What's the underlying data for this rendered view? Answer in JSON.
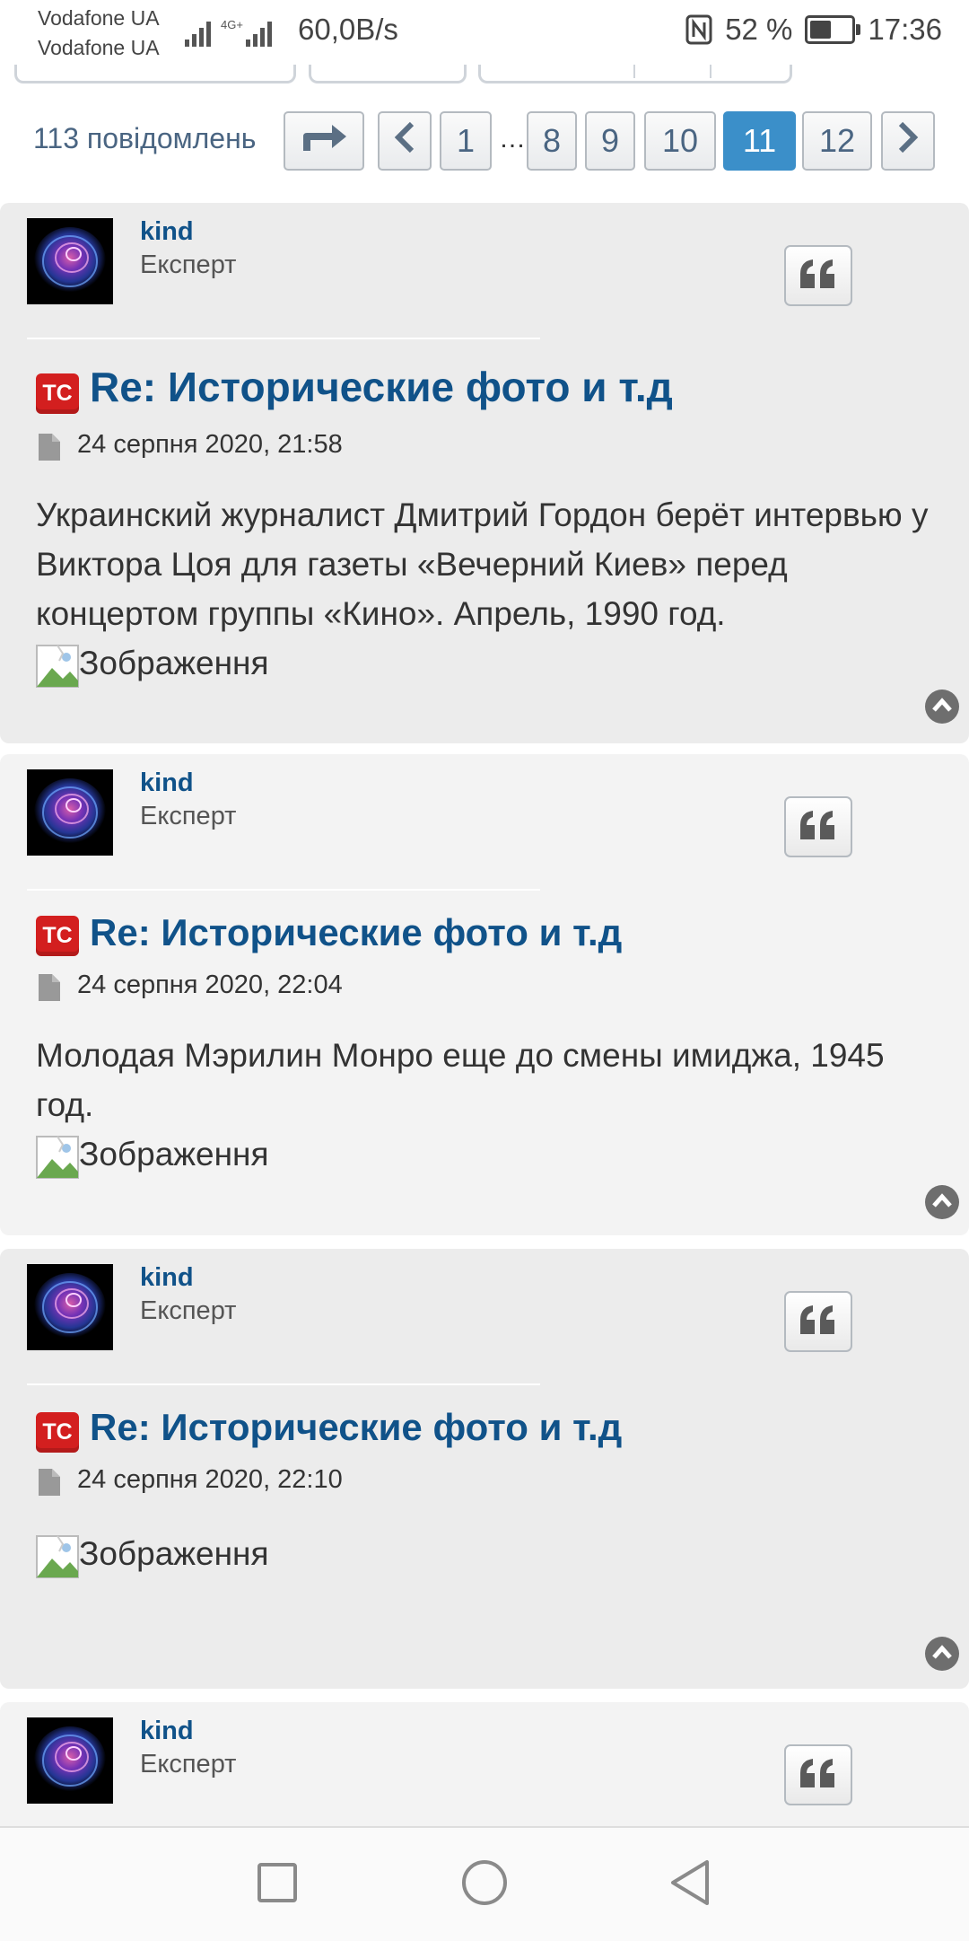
{
  "status_bar": {
    "carrier_1": "Vodafone UA",
    "carrier_2": "Vodafone UA",
    "network": "4G+",
    "speed": "60,0B/s",
    "nfc_icon": "nfc-icon",
    "battery": "52 %",
    "battery_level": 0.52,
    "time": "17:36"
  },
  "pagination": {
    "count_label": "113 повідомлень",
    "jump_icon": "jump-to-page-icon",
    "prev_icon": "chevron-left-icon",
    "pages": [
      "1",
      "…",
      "8",
      "9",
      "10",
      "11",
      "12"
    ],
    "current": "11",
    "next_icon": "chevron-right-icon"
  },
  "posts": [
    {
      "author": "kind",
      "rank": "Експерт",
      "badge": "ТС",
      "title": "Re: Исторические фото и т.д",
      "date": "24 серпня 2020, 21:58",
      "text": "Украинский журналист Дмитрий Гордон берёт интервью у Виктора Цоя для газеты «Вечерний Киев» перед концертом группы «Кино». Апрель, 1990 год.",
      "image_alt": "Зображення"
    },
    {
      "author": "kind",
      "rank": "Експерт",
      "badge": "ТС",
      "title": "Re: Исторические фото и т.д",
      "date": "24 серпня 2020, 22:04",
      "text": "Молодая Мэрилин Монро еще до смены имиджа, 1945 год.",
      "image_alt": "Зображення"
    },
    {
      "author": "kind",
      "rank": "Експерт",
      "badge": "ТС",
      "title": "Re: Исторические фото и т.д",
      "date": "24 серпня 2020, 22:10",
      "text": "",
      "image_alt": "Зображення"
    },
    {
      "author": "kind",
      "rank": "Експерт"
    }
  ],
  "colors": {
    "link": "#105289",
    "active_page": "#3b8fc9",
    "badge_red": "#d31f1f"
  },
  "nav_bar": {
    "recents_icon": "recents-square-icon",
    "home_icon": "home-circle-icon",
    "back_icon": "back-triangle-icon"
  }
}
